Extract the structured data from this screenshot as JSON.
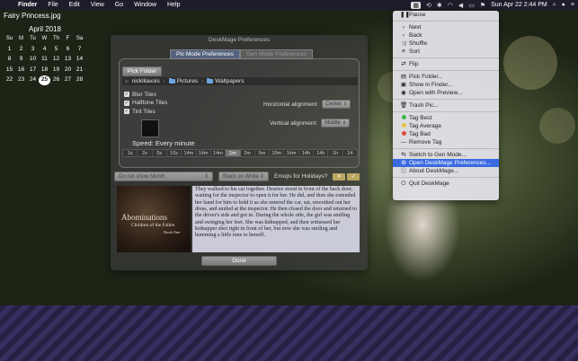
{
  "menubar": {
    "apple": "",
    "items": [
      "Finder",
      "File",
      "Edit",
      "View",
      "Go",
      "Window",
      "Help"
    ],
    "clock": "Sun Apr 22  2:44 PM"
  },
  "desktop": {
    "file_title": "Fairy Princess.jpg"
  },
  "calendar": {
    "title": "April 2018",
    "headers": [
      "Su",
      "M",
      "Tu",
      "W",
      "Th",
      "F",
      "Sa"
    ],
    "weeks": [
      [
        "1",
        "2",
        "3",
        "4",
        "5",
        "6",
        "7"
      ],
      [
        "8",
        "9",
        "10",
        "11",
        "12",
        "13",
        "14"
      ],
      [
        "15",
        "16",
        "17",
        "18",
        "19",
        "20",
        "21"
      ],
      [
        "22",
        "23",
        "24",
        "25",
        "26",
        "27",
        "28"
      ]
    ],
    "today": "25"
  },
  "prefs": {
    "title": "DeskMage Preferences",
    "tabs": [
      "Pic Mode Preferences",
      "Gen Mode Preferences"
    ],
    "pick_folder": "Pick Folder",
    "path": [
      "nicklilavois",
      "Pictures",
      "Wallpapers"
    ],
    "checkboxes": [
      "Blur Tiles",
      "Halftone Tiles",
      "Tint Tiles"
    ],
    "horizontal_label": "Horizontal alignment:",
    "horizontal_value": "Center",
    "vertical_label": "Vertical alignment:",
    "vertical_value": "Middle",
    "speed_label": "Speed: Every minute",
    "speeds": [
      "1s",
      "2s",
      "5s",
      "10s",
      "14m",
      "14m",
      "14m",
      "1m",
      "2m",
      "5m",
      "10m",
      "14m",
      "14h",
      "14h",
      "1h",
      "14"
    ],
    "selected_speed": 7,
    "month_select": "Do not show Month",
    "color_select": "Black on White",
    "emoji_label": "Emojis for Holidays?",
    "story": "They walked to his car together. Desiree stood in front of the back door, waiting for the inspector to open it for her. He did, and then she extended her hand for him to hold it as she entered the car, sat, smoothed out her dress, and smiled at the inspector. He then closed the door and returned to the driver's side and got in. During the whole ride, the girl was smiling and swinging her feet. She was kidnapped, and then witnessed her kidnapper shot right in front of her, but now she was smiling and humming a little tune to herself.",
    "book": {
      "title": "Abominations",
      "subtitle": "Children of the Fallen",
      "note": "Book One"
    },
    "done": "Done"
  },
  "dropdown": {
    "items": [
      {
        "icon": "pause-icon",
        "glyph": "❚❚",
        "label": "Pause"
      },
      {
        "sep": true
      },
      {
        "icon": "next-icon",
        "glyph": "›",
        "label": "Next"
      },
      {
        "icon": "back-icon",
        "glyph": "‹",
        "label": "Back"
      },
      {
        "icon": "shuffle-icon",
        "glyph": "⤨",
        "label": "Shuffle"
      },
      {
        "icon": "sort-icon",
        "glyph": "≡",
        "label": "Sort"
      },
      {
        "sep": true
      },
      {
        "icon": "flip-icon",
        "glyph": "⇄",
        "label": "Flip"
      },
      {
        "sep": true
      },
      {
        "icon": "pick-folder-icon",
        "glyph": "▤",
        "label": "Pick Folder..."
      },
      {
        "icon": "finder-icon",
        "glyph": "▣",
        "label": "Show in Finder..."
      },
      {
        "icon": "preview-icon",
        "glyph": "◉",
        "label": "Open with Preview..."
      },
      {
        "sep": true
      },
      {
        "icon": "trash-icon",
        "glyph": "🗑",
        "label": "Trash Pic..."
      },
      {
        "sep": true
      },
      {
        "icon": "tag-best-icon",
        "dot": "green",
        "label": "Tag Best"
      },
      {
        "icon": "tag-average-icon",
        "dot": "yellow",
        "label": "Tag Average"
      },
      {
        "icon": "tag-bad-icon",
        "dot": "red",
        "label": "Tag Bad"
      },
      {
        "icon": "remove-tag-icon",
        "glyph": "—",
        "label": "Remove Tag"
      },
      {
        "sep": true
      },
      {
        "icon": "switch-mode-icon",
        "glyph": "⇆",
        "label": "Switch to Gen Mode..."
      },
      {
        "icon": "gear-icon",
        "glyph": "⚙",
        "label": "Open DeskMage Preferences...",
        "highlight": true
      },
      {
        "icon": "info-icon",
        "glyph": "ⓘ",
        "label": "About DeskMage..."
      },
      {
        "sep": true
      },
      {
        "icon": "quit-icon",
        "glyph": "⏻",
        "label": "Quit DeskMage"
      }
    ]
  }
}
